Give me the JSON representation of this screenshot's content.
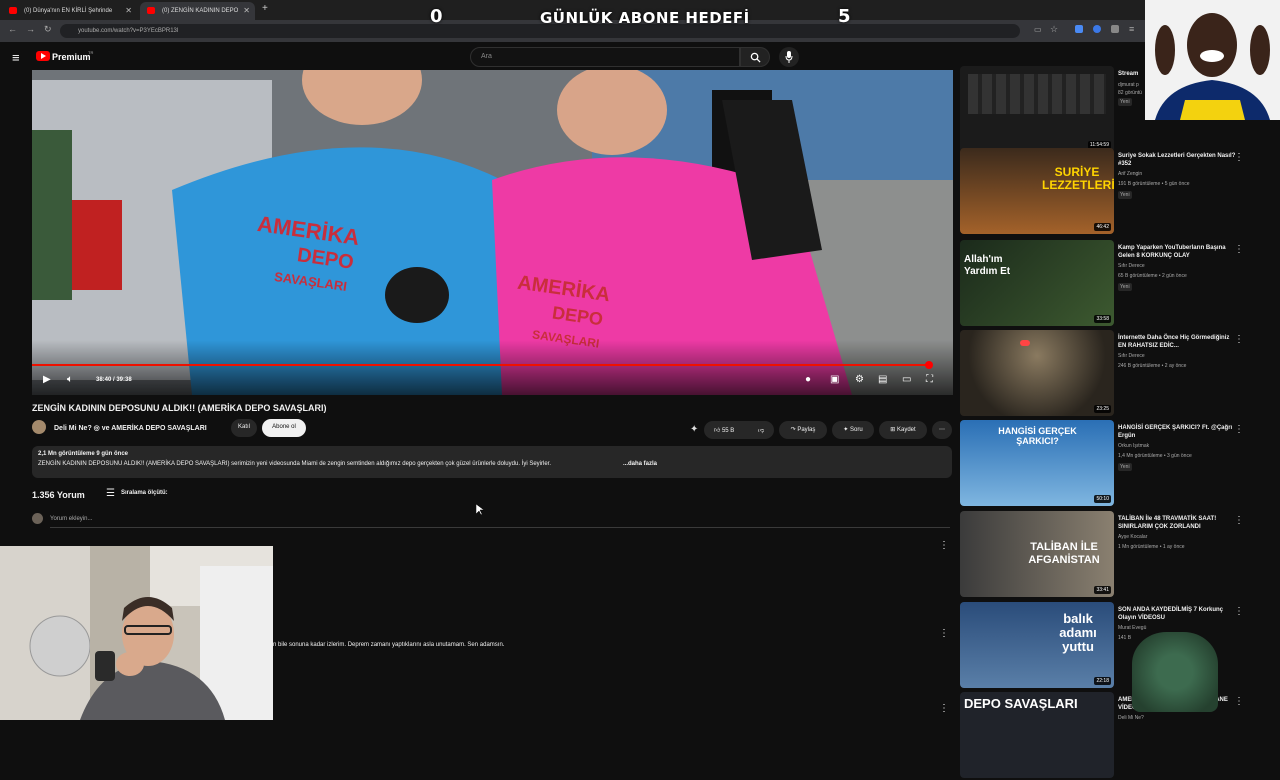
{
  "browser": {
    "tabs": [
      {
        "title": "(0) Dünya'nın EN KİRLİ Şehrinde"
      },
      {
        "title": "(0) ZENGİN KADININ DEPO"
      }
    ],
    "new_tab": "+",
    "url": "youtube.com/watch?v=P3YEcBPR13I"
  },
  "overlay": {
    "left_count": "0",
    "title": "GÜNLÜK ABONE HEDEFİ",
    "right_count": "5"
  },
  "header": {
    "logo_text": "Premium",
    "logo_sup": "TR",
    "search_placeholder": "Ara"
  },
  "video": {
    "time": "38:40 / 39:38",
    "progress": 0.975,
    "shirt_text_1": "AMERİKA",
    "shirt_text_2": "DEPO",
    "shirt_text_3": "SAVAŞLARI"
  },
  "meta": {
    "title": "ZENGİN KADININ DEPOSUNU ALDIK!! (AMERİKA DEPO SAVAŞLARI)",
    "channel": "Deli Mi Ne? ◎ ve AMERİKA DEPO SAVAŞLARI",
    "join_label": "Katıl",
    "subscribe_label": "Abone ol",
    "likes": "55 B",
    "share_label": "Paylaş",
    "ask_label": "Soru",
    "save_label": "Kaydet",
    "views_line": "2,1 Mn görüntüleme  9 gün önce",
    "description": "ZENGİN KADININ DEPOSUNU ALDIK!! (AMERİKA DEPO SAVAŞLARI) serimizin yeni videosunda Miami de zengin semtinden aldığımız depo gerçekten çok güzel ürünlerle doluydu. İyi Seyirler.",
    "more": "...daha fazla"
  },
  "comments": {
    "count": "1.356 Yorum",
    "sort_label": "Sıralama ölçütü:",
    "add_placeholder": "Yorum ekleyin...",
    "comment_fragment": "n bile sonuna kadar izlerim. Deprem zamanı yaptıklarını asla unutamam. Sen adamsın."
  },
  "sidebar": [
    {
      "title": "Stream",
      "channel": "djmurat p",
      "views": "82 görüntü",
      "new": "Yeni",
      "duration": "11:54:59"
    },
    {
      "title": "Suriye Sokak Lezzetleri Gerçekten Nasıl? #352",
      "channel": "Arif Zengin",
      "views": "191 B görüntüleme • 5 gün önce",
      "new": "Yeni",
      "duration": "46:42",
      "thumb_text": "SURİYE LEZZETLERİ"
    },
    {
      "title": "Kamp Yaparken YouTuberların Başına Gelen 8 KORKUNÇ OLAY",
      "channel": "Sıfır Derece",
      "views": "65 B görüntüleme • 2 gün önce",
      "new": "Yeni",
      "duration": "33:58",
      "thumb_text": "Allah'ım Yardım Et"
    },
    {
      "title": "İnternette Daha Önce Hiç Görmediğiniz EN RAHATSIZ EDİC...",
      "channel": "Sıfır Derece",
      "views": "246 B görüntüleme • 2 ay önce",
      "new": "",
      "duration": "23:25"
    },
    {
      "title": "HANGİSİ GERÇEK ŞARKICI? Ft. @Çağrı Ergün",
      "channel": "Orkun Işıtmak",
      "views": "1,4 Mn görüntüleme • 3 gün önce",
      "new": "Yeni",
      "duration": "50:10",
      "thumb_text": "HANGİSİ GERÇEK ŞARKICI?"
    },
    {
      "title": "TALİBAN İle 48 TRAVMATİK SAAT! SINIRLARIM ÇOK ZORLANDI",
      "channel": "Ayşe Kocalar",
      "views": "1 Mn görüntüleme • 1 ay önce",
      "new": "",
      "duration": "33:41",
      "thumb_text": "TALİBAN İLE AFGANİSTAN"
    },
    {
      "title": "SON ANDA KAYDEDİLMİŞ 7 Korkunç Olayın VİDEOSU",
      "channel": "Murat Evegü",
      "views": "141 B",
      "new": "",
      "duration": "22:18",
      "thumb_text": "balık adamı yuttu"
    },
    {
      "title": "AMERİKA DEPO SAVAŞLARI (EFSANE VİDEO)",
      "channel": "Deli Mi Ne?",
      "views": "",
      "new": "",
      "duration": "",
      "thumb_text": "DEPO SAVAŞLARI"
    }
  ],
  "colors": {
    "accent": "#ff0000",
    "bg": "#0f0f0f",
    "pill": "#272727"
  }
}
